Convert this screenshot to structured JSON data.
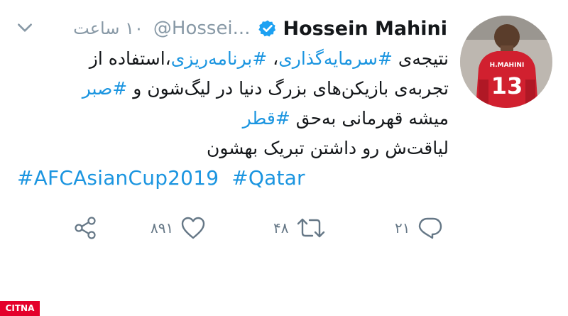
{
  "tweet": {
    "display_name": "Hossein Mahini",
    "handle": "@Hossei...",
    "time": "۱۰ ساعت",
    "verified": true,
    "lines": [
      {
        "segments": [
          {
            "text": "نتیجه‌ی ",
            "hashtag": false
          },
          {
            "text": "#سرمایه‌گذاری",
            "hashtag": true
          },
          {
            "text": "، ",
            "hashtag": false
          },
          {
            "text": "#برنامه‌ریزی",
            "hashtag": true
          },
          {
            "text": "،استفاده از",
            "hashtag": false
          }
        ]
      },
      {
        "segments": [
          {
            "text": "تجربه‌ی بازیکن‌های بزرگ دنیا در لیگ‌شون و ",
            "hashtag": false
          },
          {
            "text": "#صبر",
            "hashtag": true
          }
        ]
      },
      {
        "segments": [
          {
            "text": "میشه قهرمانی به‌حق ",
            "hashtag": false
          },
          {
            "text": "#قطر",
            "hashtag": true
          }
        ]
      },
      {
        "segments": [
          {
            "text": "لیاقت‌ش رو داشتن تبریک بهشون",
            "hashtag": false
          }
        ]
      }
    ],
    "english_hashtags": [
      "#AFCAsianCup2019",
      "#Qatar"
    ],
    "actions": {
      "reply_count": "۲۱",
      "retweet_count": "۴۸",
      "like_count": "۸۹۱"
    }
  },
  "avatar": {
    "jersey_name": "H.MAHINI",
    "jersey_number": "13"
  },
  "watermark": {
    "text": "CITNA"
  },
  "colors": {
    "link": "#1b95e0",
    "secondary": "#8899a6",
    "action_gray": "#657786",
    "verified": "#1da1f2",
    "jersey_red": "#d1202f"
  }
}
